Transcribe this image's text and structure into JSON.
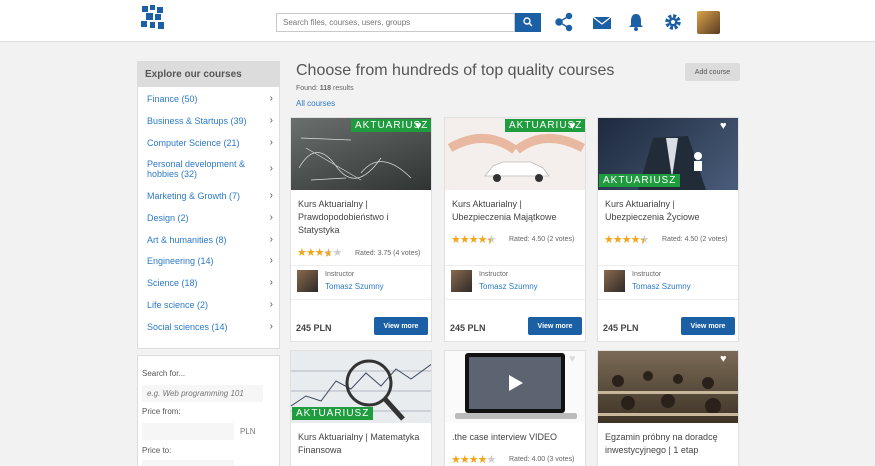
{
  "header": {
    "search_placeholder": "Search files, courses, users, groups"
  },
  "sidebar": {
    "title": "Explore our courses",
    "categories": [
      {
        "label": "Finance (50)"
      },
      {
        "label": "Business & Startups (39)"
      },
      {
        "label": "Computer Science (21)"
      },
      {
        "label": "Personal development & hobbies (32)"
      },
      {
        "label": "Marketing & Growth (7)"
      },
      {
        "label": "Design (2)"
      },
      {
        "label": "Art & humanities (8)"
      },
      {
        "label": "Engineering (14)"
      },
      {
        "label": "Science (18)"
      },
      {
        "label": "Life science (2)"
      },
      {
        "label": "Social sciences (14)"
      }
    ],
    "filters": {
      "search_label": "Search for...",
      "search_placeholder": "e.g. Web programming 101",
      "price_from_label": "Price from:",
      "price_to_label": "Price to:",
      "currency": "PLN"
    }
  },
  "main": {
    "title": "Choose from hundreds of top quality courses",
    "found_prefix": "Found: ",
    "found_count": "118",
    "found_suffix": " results",
    "all_courses": "All courses",
    "add_course": "Add course"
  },
  "courses": [
    {
      "title": "Kurs Aktuarialny | Prawdopodobieństwo i Statystyka",
      "badge": "AKTUARIUSZ",
      "rating": 3.75,
      "rated_text": "Rated: 3.75 (4 votes)",
      "instructor_label": "Instructor",
      "instructor": "Tomasz Szumny",
      "price": "245 PLN",
      "button": "View more"
    },
    {
      "title": "Kurs Aktuarialny | Ubezpieczenia Majątkowe",
      "badge": "AKTUARIUSZ",
      "rating": 4.5,
      "rated_text": "Rated: 4.50 (2 votes)",
      "instructor_label": "Instructor",
      "instructor": "Tomasz Szumny",
      "price": "245 PLN",
      "button": "View more"
    },
    {
      "title": "Kurs Aktuarialny | Ubezpieczenia Życiowe",
      "badge": "AKTUARIUSZ",
      "rating": 4.5,
      "rated_text": "Rated: 4.50 (2 votes)",
      "instructor_label": "Instructor",
      "instructor": "Tomasz Szumny",
      "price": "245 PLN",
      "button": "View more"
    },
    {
      "title": "Kurs Aktuarialny | Matematyka Finansowa",
      "badge": "AKTUARIUSZ"
    },
    {
      "title": ".the case interview VIDEO",
      "rating": 4.0,
      "rated_text": "Rated: 4.00 (3 votes)"
    },
    {
      "title": "Egzamin próbny na doradcę inwestycyjnego | 1 etap"
    }
  ],
  "colors": {
    "primary": "#1b5fa5",
    "link": "#2d79c7",
    "badge": "#1f9c3e",
    "star": "#f0a51b"
  }
}
